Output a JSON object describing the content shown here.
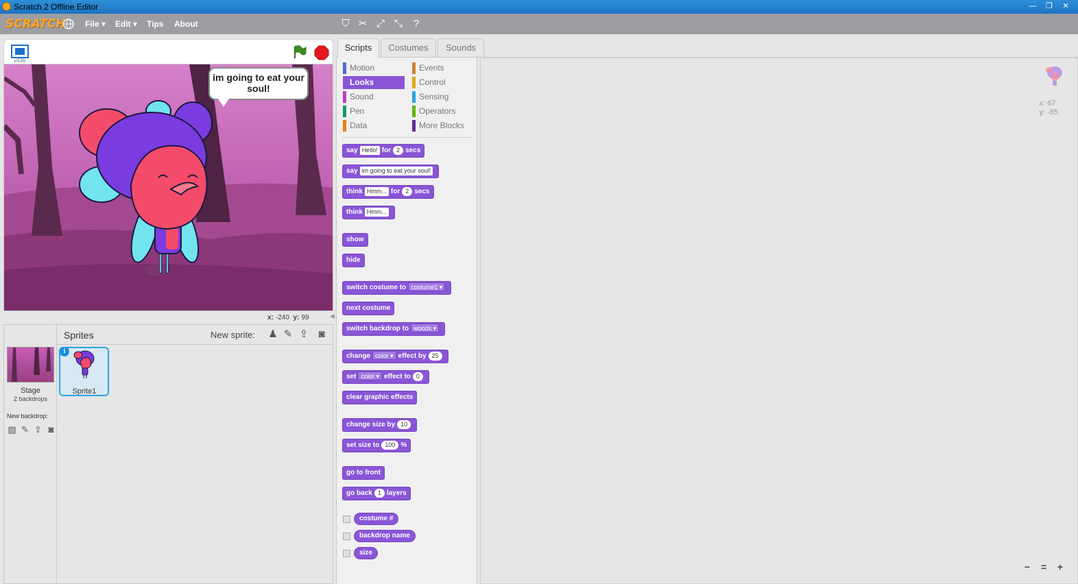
{
  "window": {
    "title": "Scratch 2 Offline Editor",
    "controls": [
      "—",
      "❐",
      "✕"
    ]
  },
  "menubar": {
    "logo": "SCRATCH",
    "items": [
      "File ▾",
      "Edit ▾",
      "Tips",
      "About"
    ],
    "tools": [
      "duplicate-icon",
      "delete-icon",
      "grow-icon",
      "shrink-icon",
      "help-icon"
    ]
  },
  "stage": {
    "version": "v436",
    "speech": "im going to eat your soul!",
    "mouse_x_label": "x:",
    "mouse_x": "-240",
    "mouse_y_label": "y:",
    "mouse_y": "99"
  },
  "sprite_pane": {
    "title": "Sprites",
    "new_sprite_label": "New sprite:",
    "stage_label": "Stage",
    "stage_sub": "2 backdrops",
    "new_backdrop_label": "New backdrop:",
    "info_label": "i",
    "sprites": [
      {
        "name": "Sprite1"
      }
    ]
  },
  "tabs": [
    "Scripts",
    "Costumes",
    "Sounds"
  ],
  "categories": {
    "left": [
      {
        "label": "Motion",
        "color": "#4a6cd4"
      },
      {
        "label": "Looks",
        "color": "#8a55d7"
      },
      {
        "label": "Sound",
        "color": "#bb42c3"
      },
      {
        "label": "Pen",
        "color": "#0e9a6c"
      },
      {
        "label": "Data",
        "color": "#ee7d16"
      }
    ],
    "right": [
      {
        "label": "Events",
        "color": "#c88330"
      },
      {
        "label": "Control",
        "color": "#e1a91a"
      },
      {
        "label": "Sensing",
        "color": "#2ca5e2"
      },
      {
        "label": "Operators",
        "color": "#5cb712"
      },
      {
        "label": "More Blocks",
        "color": "#632d99"
      }
    ],
    "selected": "Looks"
  },
  "blocks": {
    "say_for": {
      "a": "say",
      "arg": "Hello!",
      "b": "for",
      "num": "2",
      "c": "secs"
    },
    "say": {
      "a": "say",
      "arg": "im going to eat your soul!"
    },
    "think_for": {
      "a": "think",
      "arg": "Hmm...",
      "b": "for",
      "num": "2",
      "c": "secs"
    },
    "think": {
      "a": "think",
      "arg": "Hmm..."
    },
    "show": "show",
    "hide": "hide",
    "switch_costume": {
      "a": "switch costume to",
      "dd": "costume1 ▾"
    },
    "next_costume": "next costume",
    "switch_backdrop": {
      "a": "switch backdrop to",
      "dd": "woods ▾"
    },
    "change_effect": {
      "a": "change",
      "dd": "color ▾",
      "b": "effect by",
      "num": "25"
    },
    "set_effect": {
      "a": "set",
      "dd": "color ▾",
      "b": "effect to",
      "num": "0"
    },
    "clear_effects": "clear graphic effects",
    "change_size": {
      "a": "change size by",
      "num": "10"
    },
    "set_size": {
      "a": "set size to",
      "num": "100",
      "b": "%"
    },
    "go_front": "go to front",
    "go_back": {
      "a": "go back",
      "num": "1",
      "b": "layers"
    },
    "reporters": [
      "costume #",
      "backdrop name",
      "size"
    ]
  },
  "scripts_area": {
    "x_label": "x: 67",
    "y_label": "y: -85",
    "zoom": [
      "−",
      "=",
      "+"
    ]
  }
}
